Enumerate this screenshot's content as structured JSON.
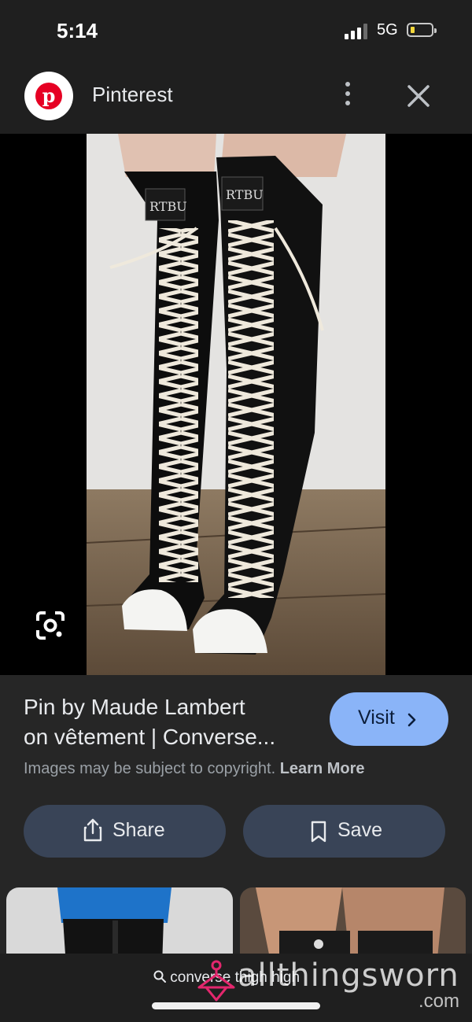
{
  "status_bar": {
    "time": "5:14",
    "network": "5G",
    "icons": [
      "signal-icon",
      "battery-icon"
    ]
  },
  "app_bar": {
    "title": "Pinterest",
    "logo_letter": "p",
    "icons": [
      "pinterest-logo",
      "more-vert-icon",
      "close-icon"
    ]
  },
  "image": {
    "label": "RTBU",
    "icons": [
      "google-lens-icon"
    ]
  },
  "pin": {
    "title_line1": "Pin by Maude Lambert",
    "title_line2": "on vêtement | Converse...",
    "visit_label": "Visit",
    "copyright_text": "Images may be subject to copyright.",
    "learn_more": "Learn More"
  },
  "actions": {
    "share_label": "Share",
    "save_label": "Save",
    "icons": [
      "share-icon",
      "bookmark-icon",
      "chevron-right-icon"
    ]
  },
  "bottom": {
    "search_query": "converse thigh high"
  },
  "watermark": {
    "text": "allthingsworn",
    "suffix": ".com"
  },
  "colors": {
    "accent": "#8ab4f8",
    "pill": "#394457",
    "background": "#1f1f1f",
    "pinterest_red": "#e60023"
  }
}
